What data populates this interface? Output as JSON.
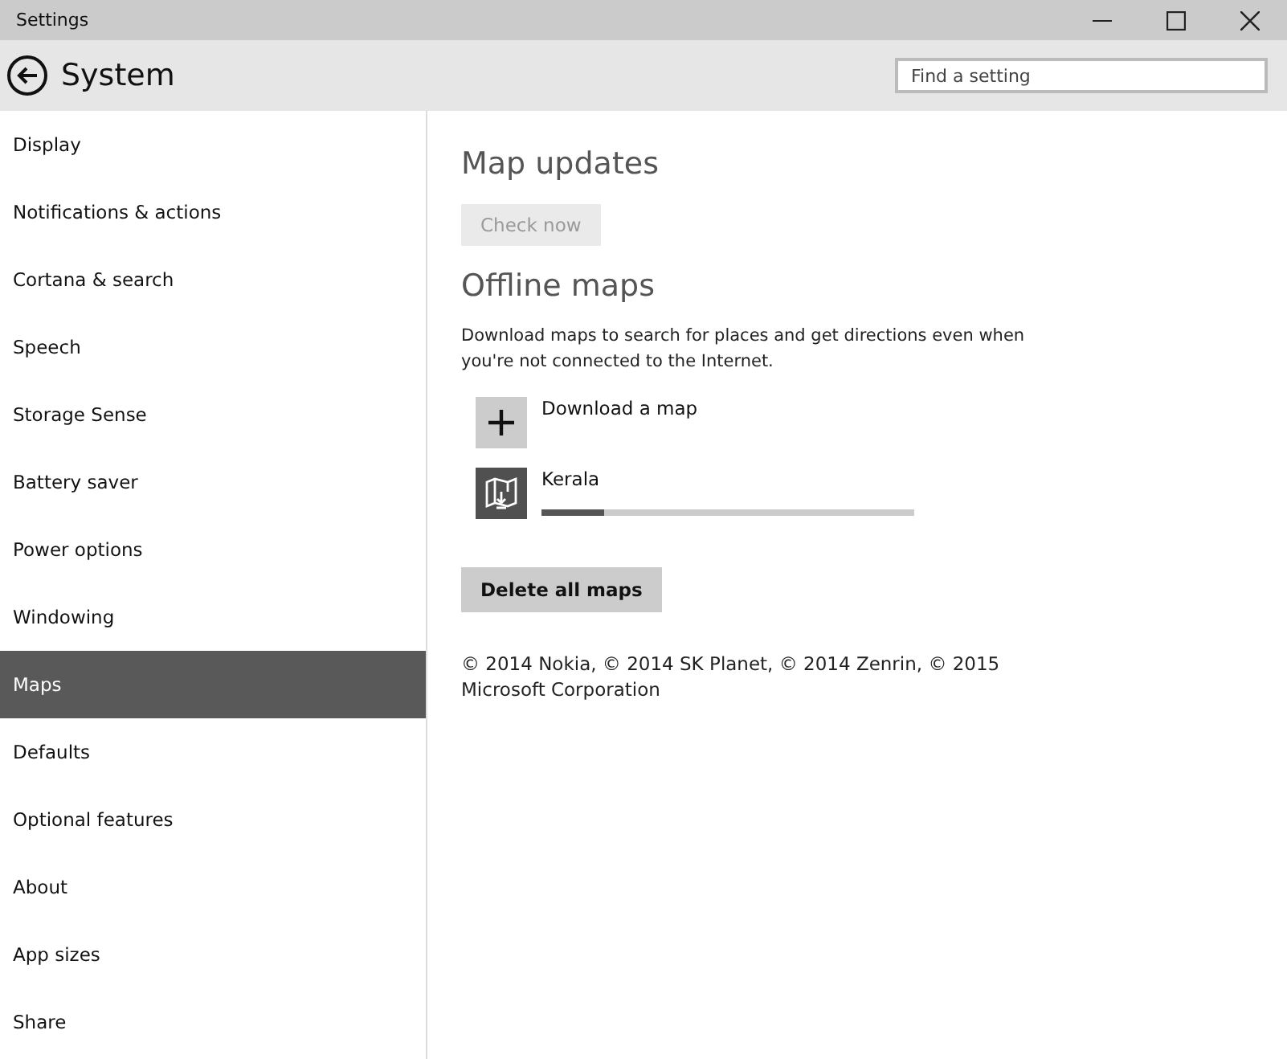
{
  "window": {
    "title": "Settings"
  },
  "header": {
    "title": "System",
    "search": {
      "placeholder": "Find a setting"
    }
  },
  "sidebar": {
    "items": [
      {
        "label": "Display",
        "selected": false
      },
      {
        "label": "Notifications & actions",
        "selected": false
      },
      {
        "label": "Cortana & search",
        "selected": false
      },
      {
        "label": "Speech",
        "selected": false
      },
      {
        "label": "Storage Sense",
        "selected": false
      },
      {
        "label": "Battery saver",
        "selected": false
      },
      {
        "label": "Power options",
        "selected": false
      },
      {
        "label": "Windowing",
        "selected": false
      },
      {
        "label": "Maps",
        "selected": true
      },
      {
        "label": "Defaults",
        "selected": false
      },
      {
        "label": "Optional features",
        "selected": false
      },
      {
        "label": "About",
        "selected": false
      },
      {
        "label": "App sizes",
        "selected": false
      },
      {
        "label": "Share",
        "selected": false
      }
    ]
  },
  "map_updates": {
    "heading": "Map updates",
    "button": {
      "label": "Check now",
      "disabled": true
    }
  },
  "offline_maps": {
    "heading": "Offline maps",
    "description": "Download maps to search for places and get directions even when you're not connected to the Internet.",
    "items": [
      {
        "kind": "add",
        "label": "Download a map"
      },
      {
        "kind": "download",
        "label": "Kerala",
        "level": 0.17
      }
    ],
    "delete_button": {
      "label": "Delete all maps",
      "disabled": false
    },
    "copyright": "© 2014 Nokia, © 2014 SK Planet, © 2014 Zenrin, © 2015 Microsoft Corporation"
  }
}
